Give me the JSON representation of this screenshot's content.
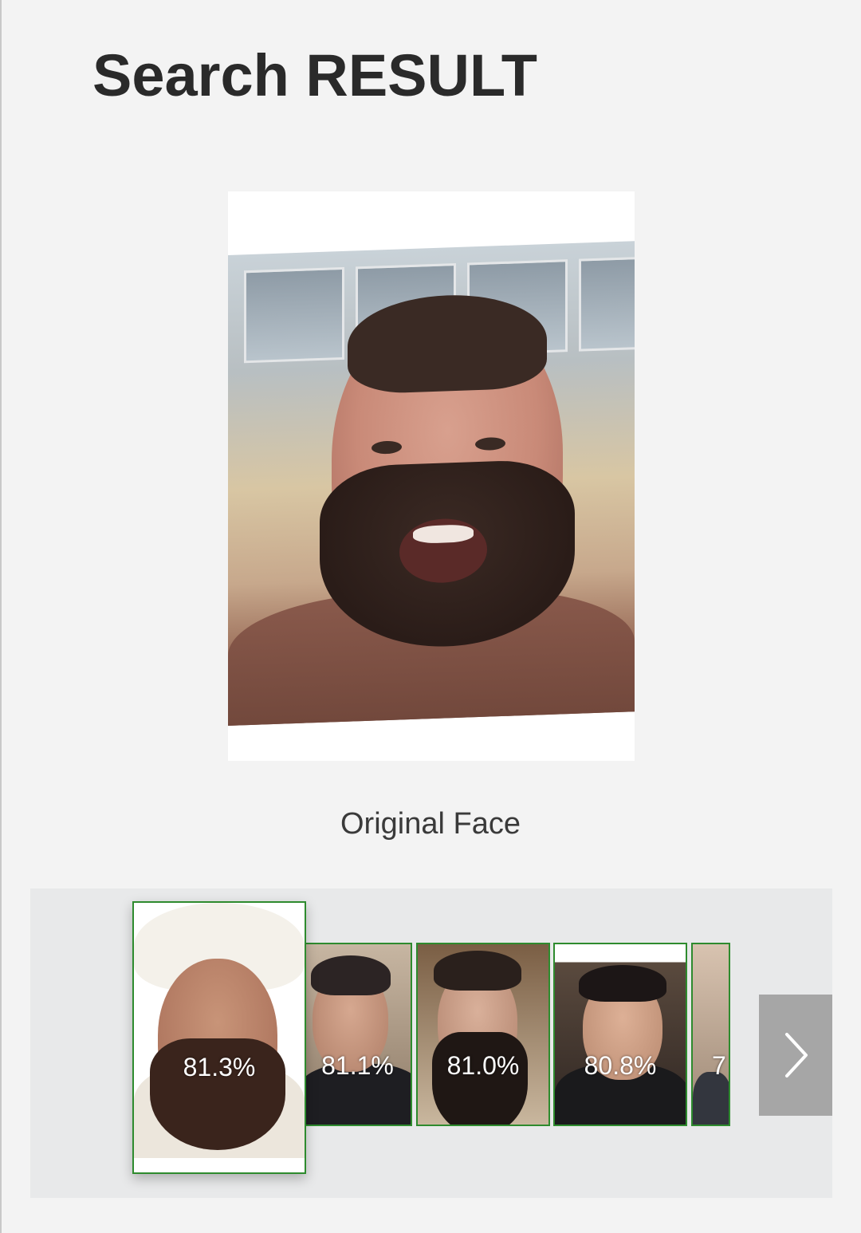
{
  "header": {
    "title": "Search RESULT"
  },
  "original": {
    "label": "Original Face"
  },
  "results": [
    {
      "percent": "81.3%",
      "selected": true
    },
    {
      "percent": "81.1%",
      "selected": false
    },
    {
      "percent": "81.0%",
      "selected": false
    },
    {
      "percent": "80.8%",
      "selected": false
    },
    {
      "percent": "7",
      "selected": false
    }
  ],
  "colors": {
    "background": "#f3f3f3",
    "strip": "#e8e9ea",
    "thumb_border": "#2e8b2e",
    "next_button": "#a6a6a6"
  },
  "icons": {
    "next": "chevron-right-icon"
  }
}
